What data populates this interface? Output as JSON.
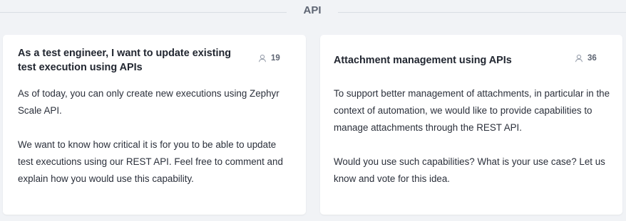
{
  "section": {
    "title": "API"
  },
  "cards": [
    {
      "title": "As a test engineer, I want to update existing test execution using APIs",
      "votes": "19",
      "paragraphs": [
        "As of today, you can only create new executions using Zephyr Scale API.",
        "We want to know how critical it is for you to be able to update test executions using our REST API. Feel free to comment and explain how you would use this capability."
      ]
    },
    {
      "title": "Attachment management using APIs",
      "votes": "36",
      "paragraphs": [
        "To support better management of attachments, in particular in the context of automation, we would like to provide capabilities to manage attachments through the REST API.",
        "Would you use such capabilities? What is your use case? Let us know and vote for this idea."
      ]
    }
  ],
  "icons": {
    "votes": "user-icon"
  },
  "colors": {
    "background": "#f1f3f6",
    "card": "#ffffff",
    "text": "#222731",
    "muted": "#5e6573"
  }
}
